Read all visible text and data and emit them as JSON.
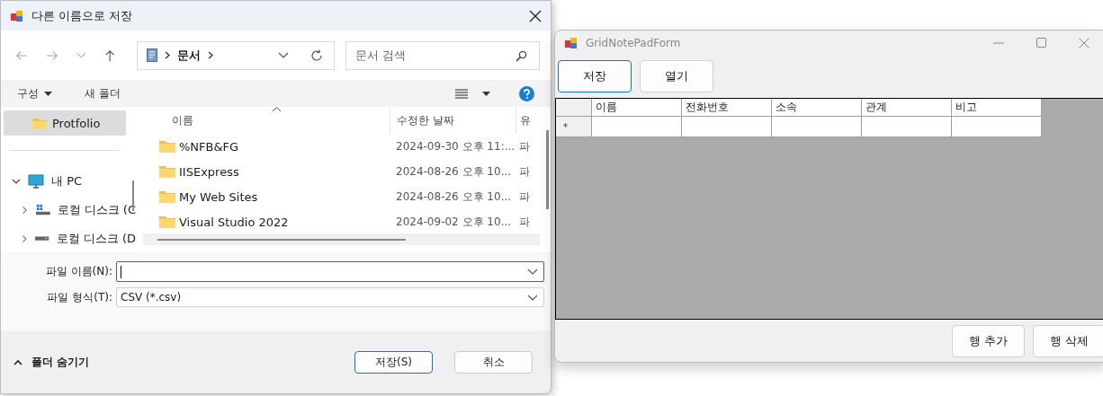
{
  "save_dialog": {
    "title": "다른 이름으로 저장",
    "address": {
      "path": "문서",
      "search_placeholder": "문서 검색"
    },
    "toolbar": {
      "organize": "구성",
      "new_folder": "새 폴더"
    },
    "nav_pane": {
      "quick_access": [
        {
          "label": "Protfolio",
          "selected": true
        }
      ],
      "tree": [
        {
          "label": "내 PC",
          "kind": "pc",
          "expanded": true,
          "children": [
            {
              "label": "로컬 디스크 (C",
              "kind": "system-drive",
              "expanded": false
            },
            {
              "label": "로컬 디스크 (D",
              "kind": "drive",
              "expanded": false
            }
          ]
        }
      ]
    },
    "file_list": {
      "columns": [
        "이름",
        "수정한 날짜",
        "유"
      ],
      "rows": [
        {
          "name": "%NFB&FG",
          "modified": "2024-09-30 오후 11:...",
          "column_3": "파"
        },
        {
          "name": "IISExpress",
          "modified": "2024-08-26 오후 10...",
          "column_3": "파"
        },
        {
          "name": "My Web Sites",
          "modified": "2024-08-26 오후 10...",
          "column_3": "파"
        },
        {
          "name": "Visual Studio 2022",
          "modified": "2024-09-02 오후 10...",
          "column_3": "파"
        }
      ]
    },
    "fields": [
      {
        "label": "파일 이름(N):",
        "focused": true
      },
      {
        "label": "파일 형식(T):",
        "value": "CSV (*.csv)",
        "focused": false
      }
    ],
    "hide_folders": "폴더 숨기기",
    "buttons": [
      {
        "label": "저장(S)",
        "primary": true
      },
      {
        "label": "취소",
        "primary": false
      }
    ]
  },
  "grid_form": {
    "title": "GridNotePadForm",
    "top_buttons": [
      {
        "label": "저장",
        "focused": true
      },
      {
        "label": "열기",
        "focused": false
      }
    ],
    "grid": {
      "columns": [
        "이름",
        "전화번호",
        "소속",
        "관계",
        "비고"
      ],
      "new_row_marker": "*"
    },
    "bottom_buttons": [
      "행 추가",
      "행 삭제"
    ]
  }
}
